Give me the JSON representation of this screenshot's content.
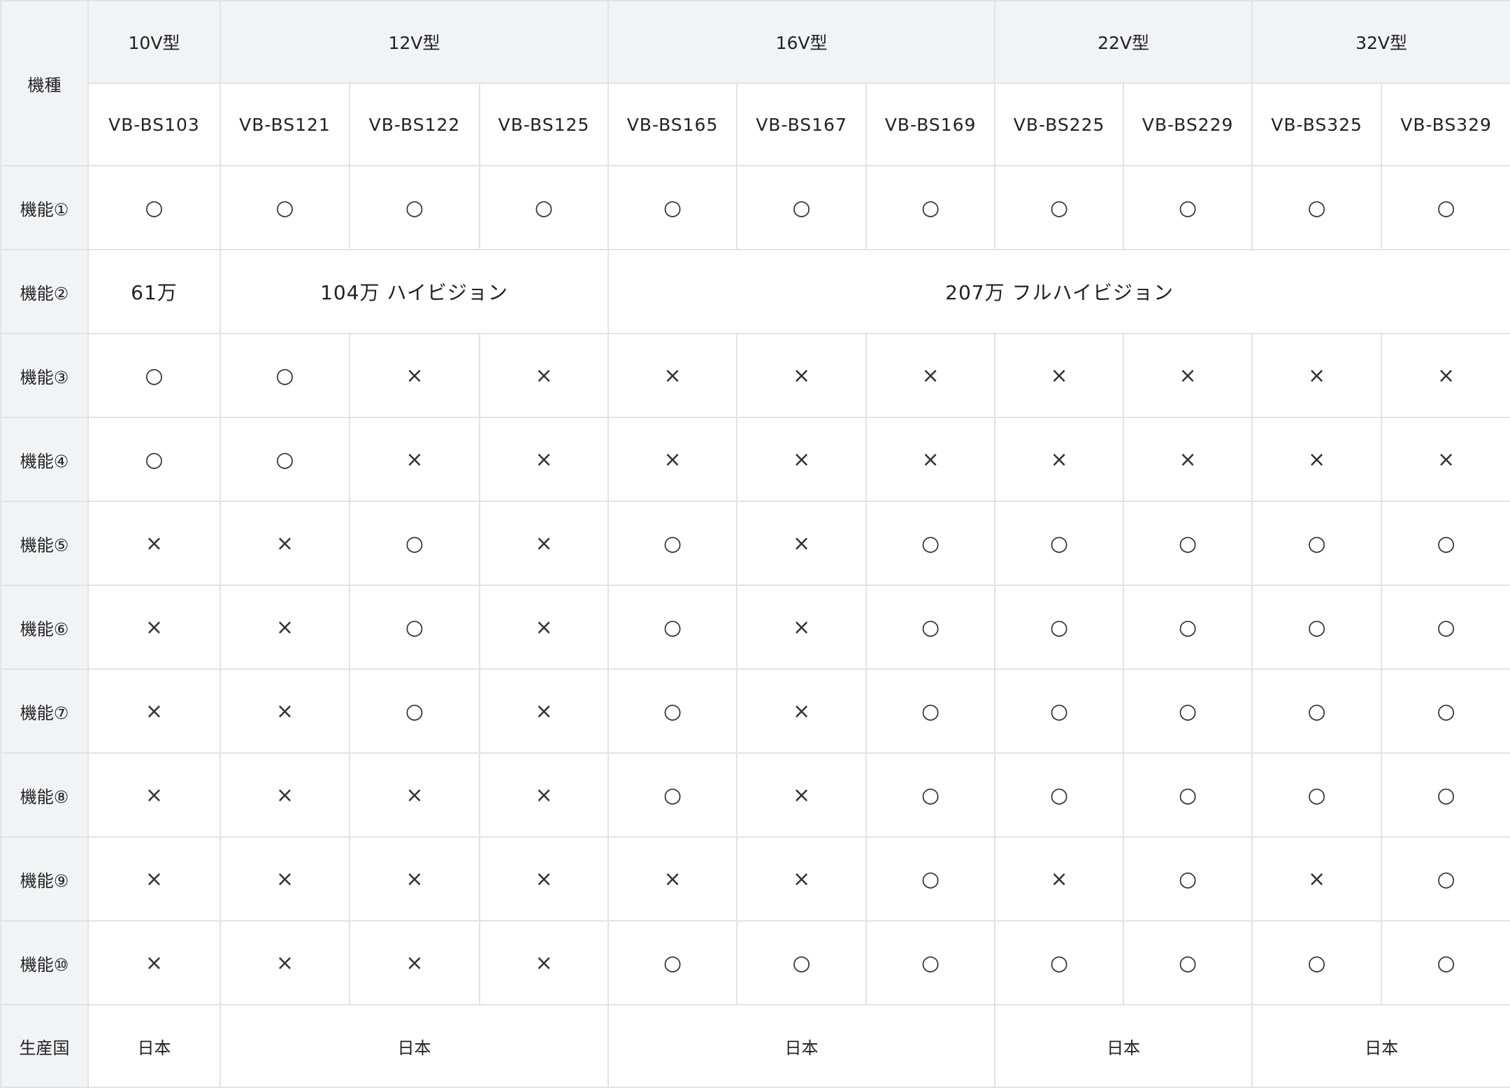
{
  "corner_label": "機種",
  "sizes": [
    "10V型",
    "12V型",
    "16V型",
    "22V型",
    "32V型"
  ],
  "models": [
    "VB-BS103",
    "VB-BS121",
    "VB-BS122",
    "VB-BS125",
    "VB-BS165",
    "VB-BS167",
    "VB-BS169",
    "VB-BS225",
    "VB-BS229",
    "VB-BS325",
    "VB-BS329"
  ],
  "rows": [
    {
      "label": "機能①",
      "cells": [
        "○",
        "○",
        "○",
        "○",
        "○",
        "○",
        "○",
        "○",
        "○",
        "○",
        "○"
      ]
    },
    {
      "label": "機能②",
      "resolution": [
        "61万",
        "104万 ハイビジョン",
        "207万 フルハイビジョン"
      ]
    },
    {
      "label": "機能③",
      "cells": [
        "○",
        "○",
        "×",
        "×",
        "×",
        "×",
        "×",
        "×",
        "×",
        "×",
        "×"
      ]
    },
    {
      "label": "機能④",
      "cells": [
        "○",
        "○",
        "×",
        "×",
        "×",
        "×",
        "×",
        "×",
        "×",
        "×",
        "×"
      ]
    },
    {
      "label": "機能⑤",
      "cells": [
        "×",
        "×",
        "○",
        "×",
        "○",
        "×",
        "○",
        "○",
        "○",
        "○",
        "○"
      ]
    },
    {
      "label": "機能⑥",
      "cells": [
        "×",
        "×",
        "○",
        "×",
        "○",
        "×",
        "○",
        "○",
        "○",
        "○",
        "○"
      ]
    },
    {
      "label": "機能⑦",
      "cells": [
        "×",
        "×",
        "○",
        "×",
        "○",
        "×",
        "○",
        "○",
        "○",
        "○",
        "○"
      ]
    },
    {
      "label": "機能⑧",
      "cells": [
        "×",
        "×",
        "×",
        "×",
        "○",
        "×",
        "○",
        "○",
        "○",
        "○",
        "○"
      ]
    },
    {
      "label": "機能⑨",
      "cells": [
        "×",
        "×",
        "×",
        "×",
        "×",
        "×",
        "○",
        "×",
        "○",
        "×",
        "○"
      ]
    },
    {
      "label": "機能⑩",
      "cells": [
        "×",
        "×",
        "×",
        "×",
        "○",
        "○",
        "○",
        "○",
        "○",
        "○",
        "○"
      ]
    }
  ],
  "country": {
    "label": "生産国",
    "values": [
      "日本",
      "日本",
      "日本",
      "日本",
      "日本"
    ]
  }
}
